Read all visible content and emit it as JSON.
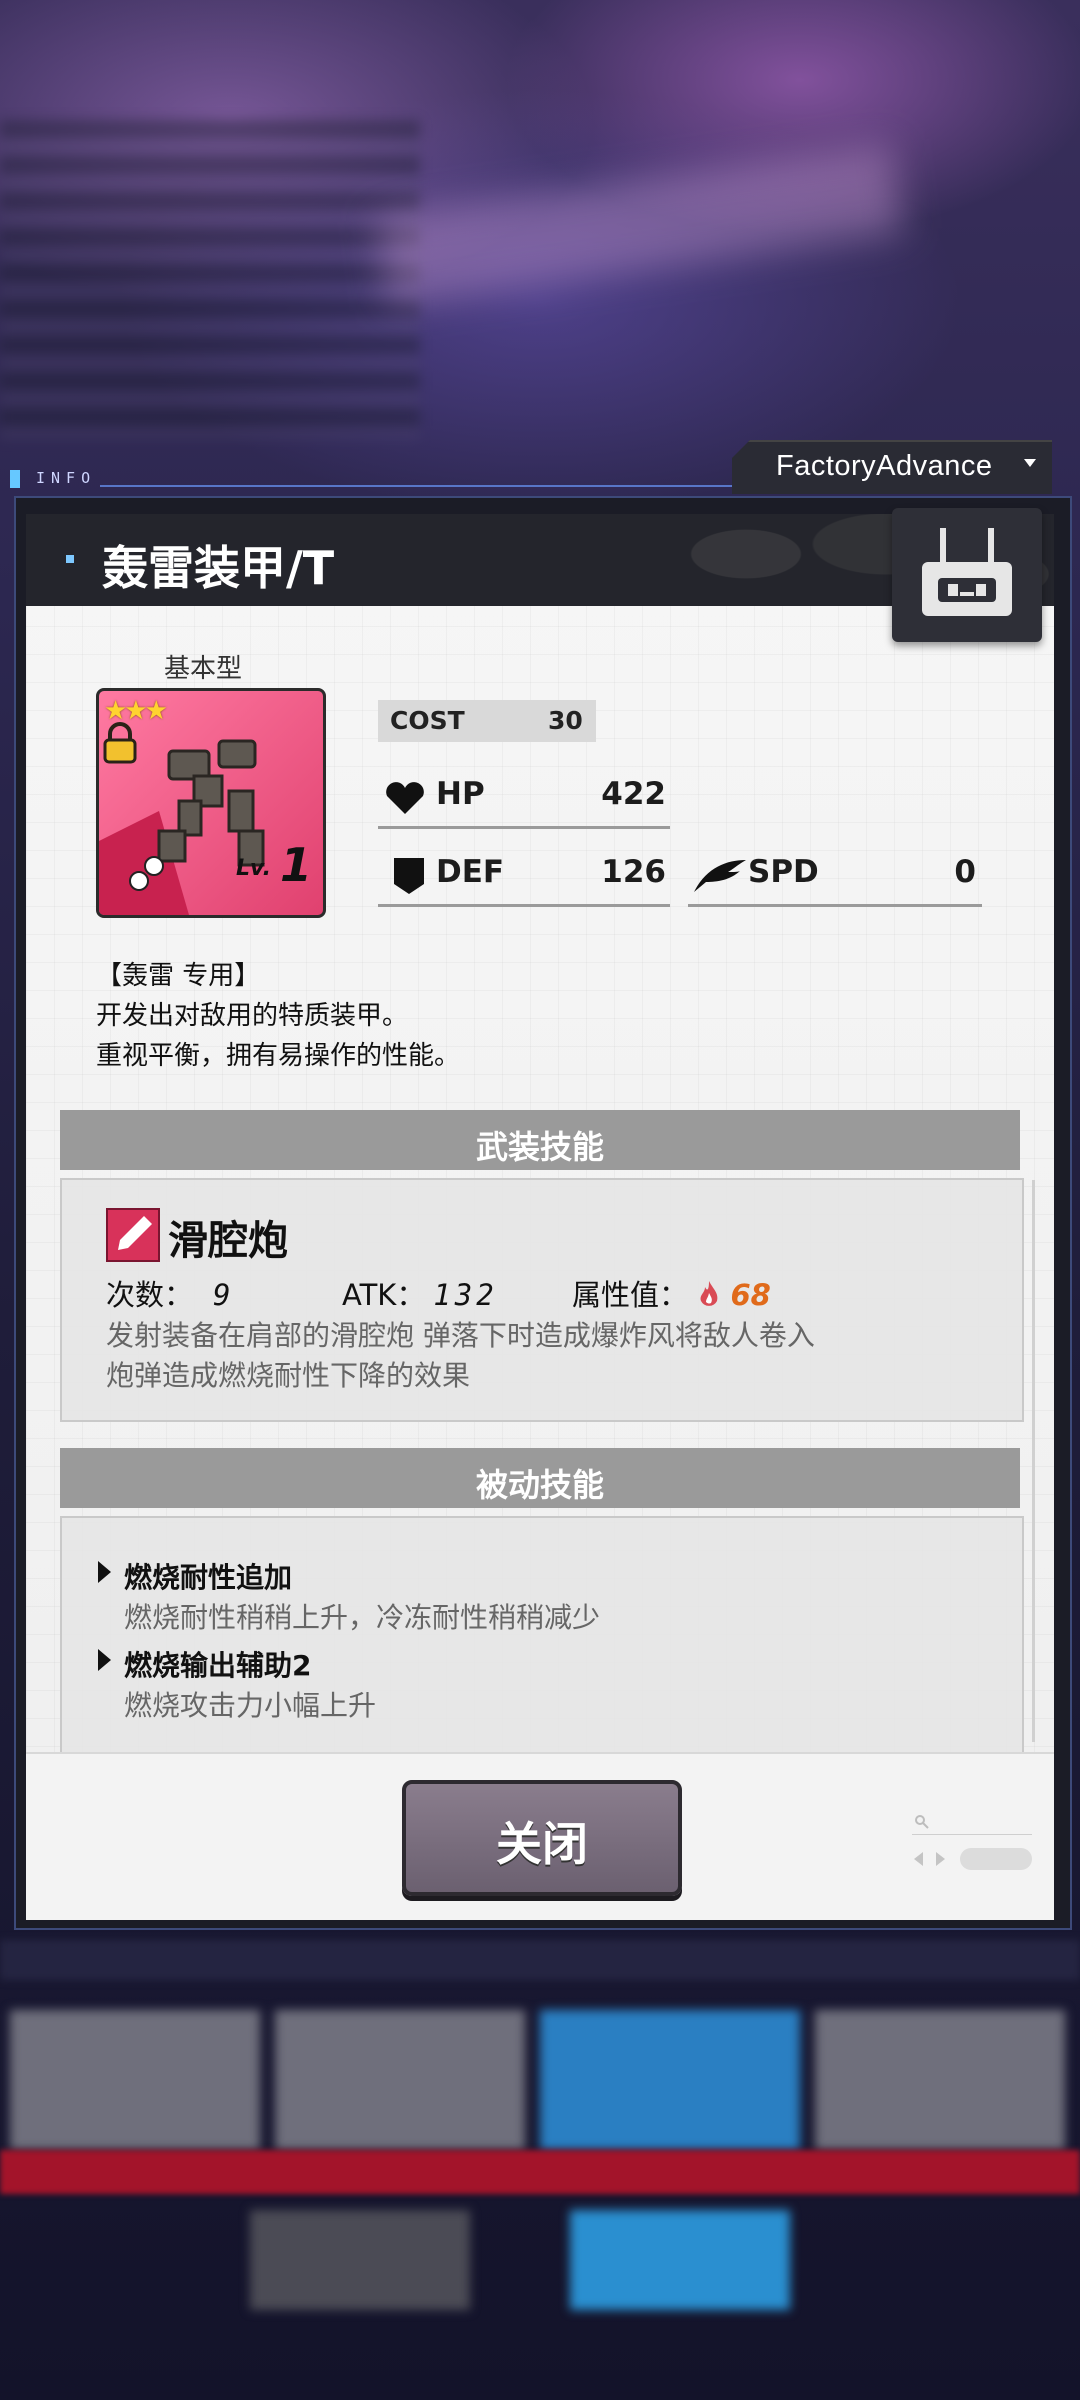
{
  "topbar": {
    "info_label": "INFO",
    "mode_dropdown": "FactoryAdvance"
  },
  "unit": {
    "name": "轰雷装甲/T",
    "type": "基本型",
    "stars": 3,
    "level_prefix": "Lv.",
    "level": "1"
  },
  "stats": {
    "cost_label": "COST",
    "cost": "30",
    "hp_label": "HP",
    "hp": "422",
    "def_label": "DEF",
    "def": "126",
    "spd_label": "SPD",
    "spd": "0"
  },
  "description": {
    "line1": "【轰雷 专用】",
    "line2": "开发出对敌用的特质装甲。",
    "line3": "重视平衡，拥有易操作的性能。"
  },
  "armed_skill": {
    "section_title": "武装技能",
    "name": "滑腔炮",
    "uses_label": "次数：",
    "uses": "9",
    "atk_label": "ATK：",
    "atk": "132",
    "attr_label": "属性值：",
    "attr_value": "68",
    "desc_line1": "发射装备在肩部的滑腔炮 弹落下时造成爆炸风将敌人卷入",
    "desc_line2": "炮弹造成燃烧耐性下降的效果"
  },
  "passive_skills": {
    "section_title": "被动技能",
    "items": [
      {
        "title": "燃烧耐性追加",
        "desc": "燃烧耐性稍稍上升，冷冻耐性稍稍减少"
      },
      {
        "title": "燃烧输出辅助2",
        "desc": "燃烧攻击力小幅上升"
      }
    ]
  },
  "footer": {
    "close_label": "关闭"
  },
  "colors": {
    "header_bg": "#24252c",
    "section_bar": "#9a9a9a",
    "attr_fire": "#e06a1a",
    "portrait_bg": "#e0416f",
    "close_button": "#7a6e7e"
  },
  "icons": {
    "hp": "heart-icon",
    "def": "shield-icon",
    "spd": "wing-icon",
    "attr": "flame-icon",
    "skill": "pen-icon",
    "badge": "robot-icon",
    "lock": "lock-icon"
  }
}
